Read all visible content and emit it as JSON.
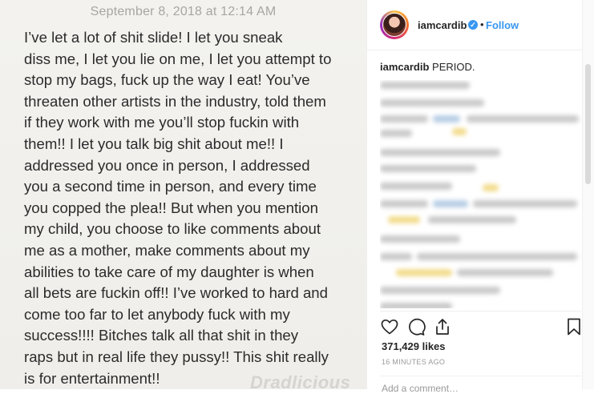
{
  "note": {
    "date": "September 8, 2018 at 12:14 AM",
    "lines": [
      "I’ve let a lot of shit slide! I let you sneak",
      "diss me, I let you lie on me, I let you attempt to",
      "stop my bags, fuck up the way I eat! You’ve",
      "threaten other artists in the industry, told them",
      "if they work with me you’ll stop fuckin with",
      "them!! I let you talk big shit about me!! I",
      "addressed you once in person, I addressed",
      "you a second time in person, and every time",
      "you copped the plea!! But when you mention",
      "my child, you choose to like comments about",
      "me as a mother, make comments about my",
      "abilities to take care of my daughter is when",
      "all bets are fuckin off!! I’ve worked to hard and",
      "come too far to let anybody fuck with my",
      "success!!!! Bitches talk all that shit in they",
      "raps but in real life they pussy!! This shit really",
      "is for entertainment!!"
    ],
    "watermark": "Dradlicious"
  },
  "post": {
    "username": "iamcardib",
    "verified_mark": "✓",
    "separator": "•",
    "follow_label": "Follow",
    "caption_user": "iamcardib",
    "caption_text": "PERIOD.",
    "likes": "371,429 likes",
    "time": "16 MINUTES AGO",
    "add_comment_placeholder": "Add a comment…"
  },
  "icons": [
    "heart-icon",
    "comment-icon",
    "share-icon",
    "bookmark-icon"
  ],
  "colors": {
    "link": "#3897f0",
    "text": "#262626",
    "muted": "#999999"
  }
}
